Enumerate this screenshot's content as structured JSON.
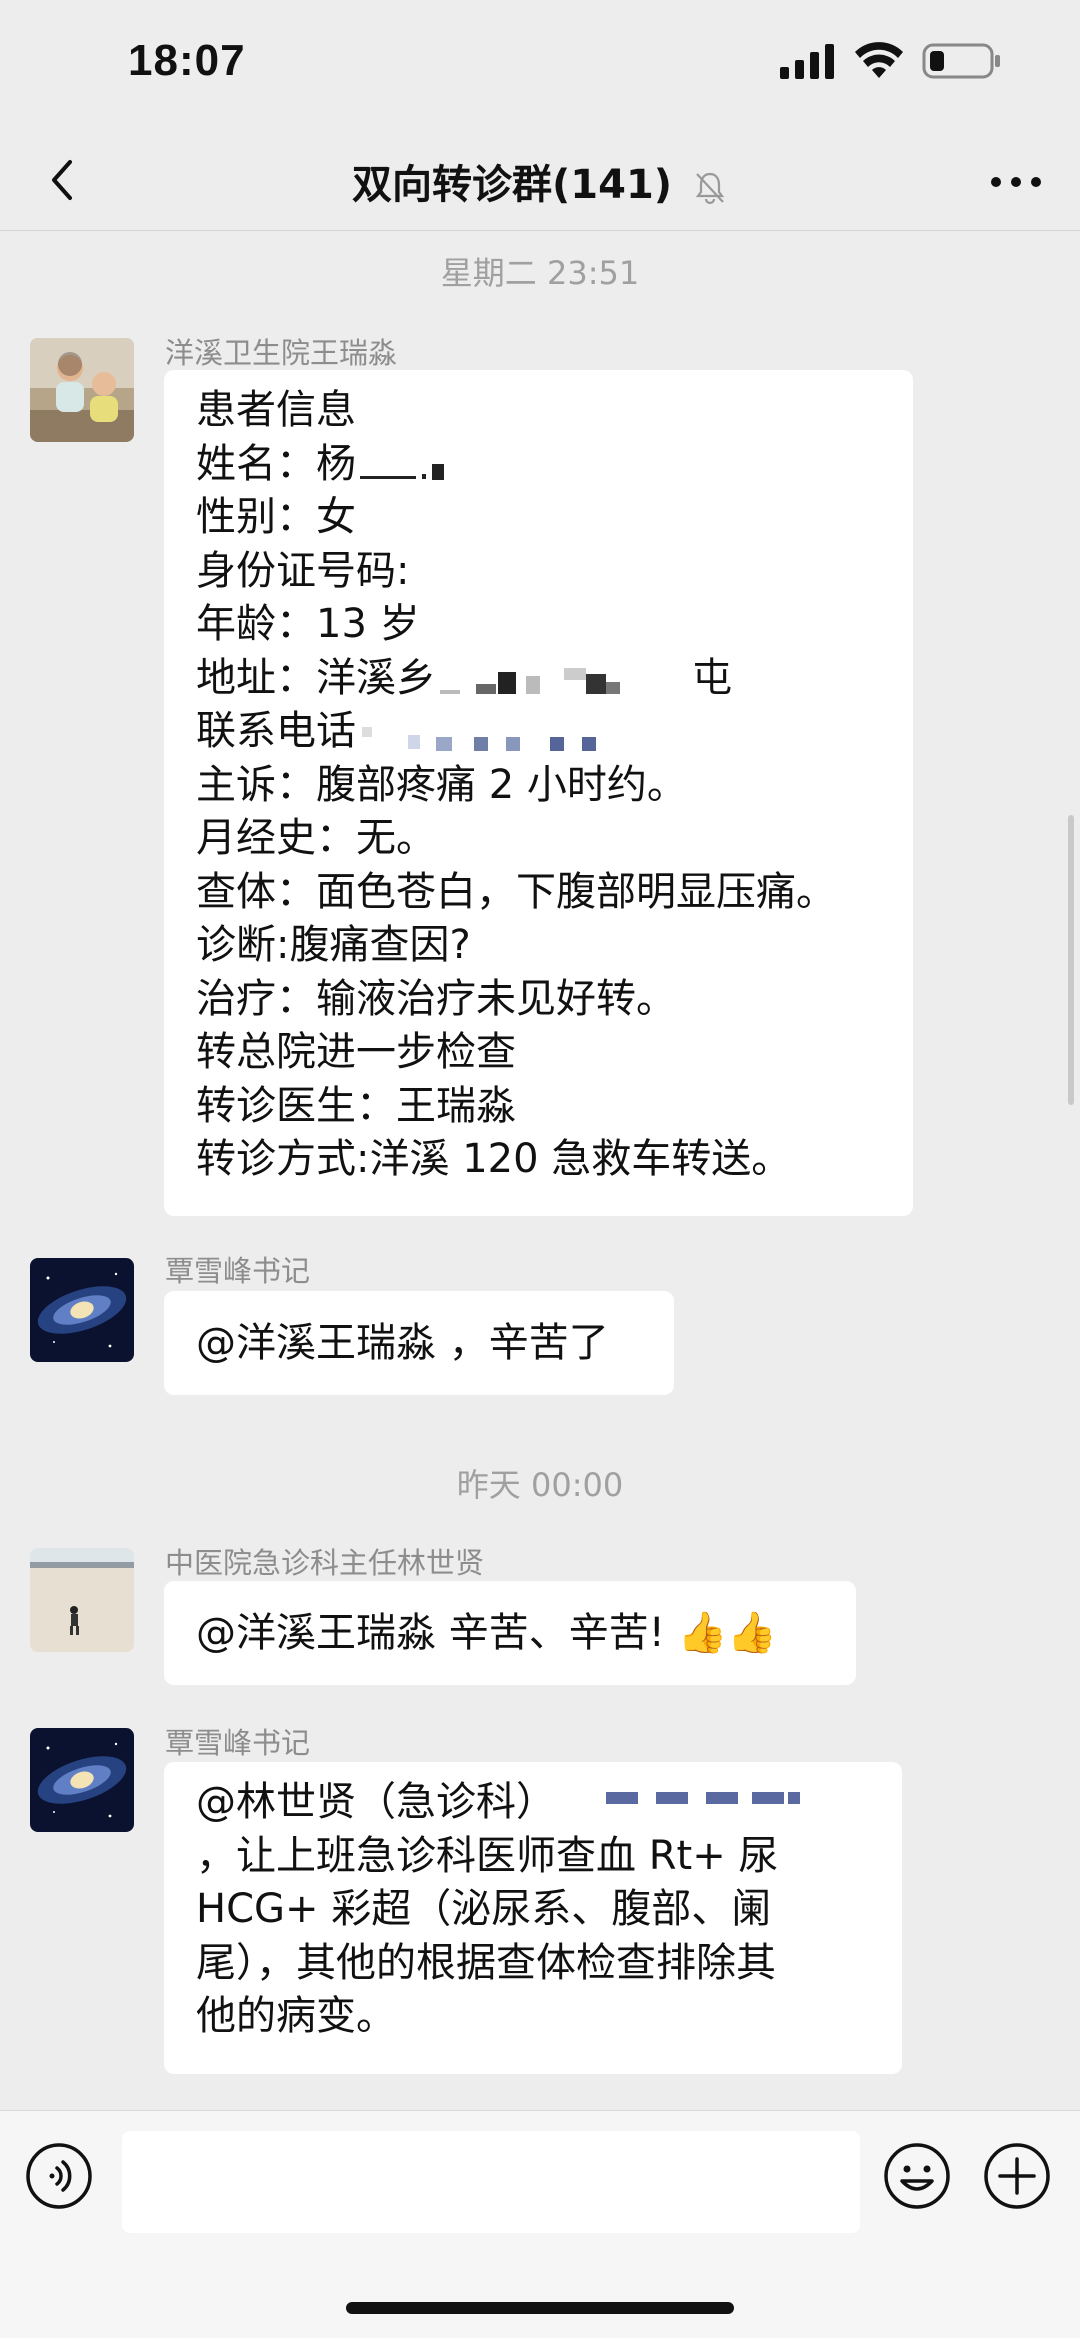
{
  "status": {
    "time": "18:07"
  },
  "nav": {
    "title": "双向转诊群(141)"
  },
  "timestamps": [
    "星期二 23:51",
    "昨天 00:00"
  ],
  "messages": [
    {
      "sender": "洋溪卫生院王瑞淼",
      "avatar": "children-photo-avatar",
      "lines": [
        "患者信息",
        "姓名：杨",
        "性别：女",
        "身份证号码:",
        "年龄：13 岁",
        "地址：洋溪乡",
        "屯",
        "联系电话",
        "主诉：腹部疼痛 2 小时约。",
        "月经史：无。",
        "查体：面色苍白，下腹部明显压痛。",
        "诊断:腹痛查因?",
        "治疗：输液治疗未见好转。",
        "转总院进一步检查",
        "转诊医生：王瑞淼",
        "转诊方式:洋溪 120 急救车转送。"
      ]
    },
    {
      "sender": "覃雪峰书记",
      "avatar": "galaxy-avatar",
      "text": "@洋溪王瑞淼 ，辛苦了"
    },
    {
      "sender": "中医院急诊科主任林世贤",
      "avatar": "beach-photo-avatar",
      "text": "@洋溪王瑞淼 辛苦、辛苦!",
      "emoji": "👍👍"
    },
    {
      "sender": "覃雪峰书记",
      "avatar": "galaxy-avatar",
      "lines": [
        "@林世贤（急诊科）",
        "，让上班急诊科医师查血 Rt+ 尿",
        "HCG+ 彩超（泌尿系、腹部、阑",
        "尾），其他的根据查体检查排除其",
        "他的病变。"
      ]
    }
  ],
  "input": {
    "placeholder": ""
  }
}
